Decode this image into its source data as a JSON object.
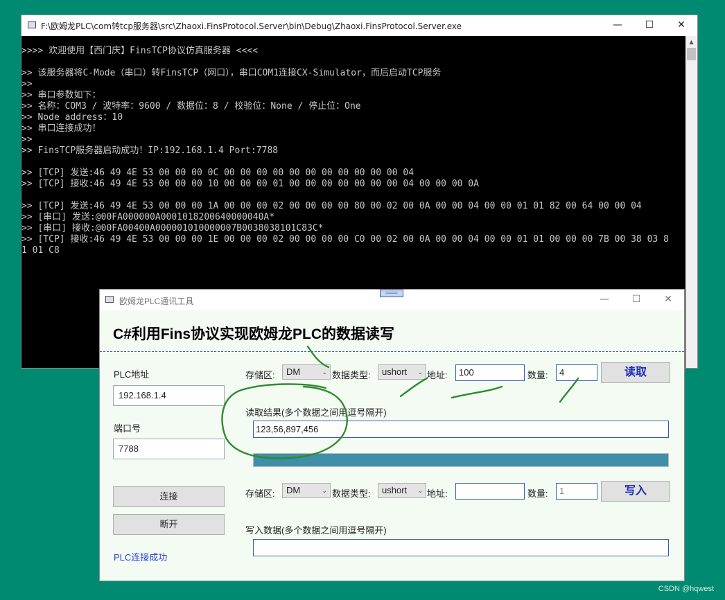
{
  "console": {
    "title": "F:\\欧姆龙PLC\\com转tcp服务器\\src\\Zhaoxi.FinsProtocol.Server\\bin\\Debug\\Zhaoxi.FinsProtocol.Server.exe",
    "minimize": "—",
    "maximize": "☐",
    "close": "✕",
    "scroll_up": "▲",
    "lines": [
      ">>>> 欢迎使用【西门庆】FinsTCP协议仿真服务器 <<<<",
      "",
      ">> 该服务器将C-Mode（串口）转FinsTCP（网口），串口COM1连接CX-Simulator，而后启动TCP服务",
      ">>",
      ">> 串口参数如下：",
      ">> 名称：COM3 / 波特率：9600 / 数据位：8 / 校验位：None / 停止位：One",
      ">> Node address：10",
      ">> 串口连接成功！",
      ">>",
      ">> FinsTCP服务器启动成功！IP:192.168.1.4  Port:7788",
      "",
      ">> [TCP] 发送:46 49 4E 53 00 00 00 0C 00 00 00 00 00 00 00 00 00 00 00 04",
      ">> [TCP] 接收:46 49 4E 53 00 00 00 10 00 00 00 01 00 00 00 00 00 00 00 04 00 00 00 0A",
      "",
      ">> [TCP] 发送:46 49 4E 53 00 00 00 1A 00 00 00 02 00 00 00 00 80 00 02 00 0A 00 00 04 00 00 01 01 82 00 64 00 00 04",
      ">> [串口] 发送:@00FA000000A0001018200640000040A*",
      ">> [串口] 接收:@00FA00400A000001010000007B0038038101C83C*",
      ">> [TCP] 接收:46 49 4E 53 00 00 00 1E 00 00 00 02 00 00 00 00 C0 00 02 00 0A 00 00 04 00 00 01 01 00 00 00 7B 00 38 03 8",
      "1 01 C8"
    ]
  },
  "form": {
    "title": "欧姆龙PLC通讯工具",
    "minimize": "—",
    "maximize": "☐",
    "close": "✕",
    "grip": "═══",
    "heading": "C#利用Fins协议实现欧姆龙PLC的数据读写",
    "plc_address_label": "PLC地址",
    "plc_address_value": "192.168.1.4",
    "port_label": "端口号",
    "port_value": "7788",
    "connect_button": "连接",
    "disconnect_button": "断开",
    "status_text": "PLC连接成功",
    "read": {
      "area_label": "存储区:",
      "area_value": "DM",
      "type_label": "数据类型:",
      "type_value": "ushort",
      "address_label": "地址:",
      "address_value": "100",
      "count_label": "数量:",
      "count_value": "4",
      "button": "读取",
      "result_label": "读取结果(多个数据之间用逗号隔开)",
      "result_value": "123,56,897,456",
      "progress": 1.0
    },
    "write": {
      "area_label": "存储区:",
      "area_value": "DM",
      "type_label": "数据类型:",
      "type_value": "ushort",
      "address_label": "地址:",
      "address_value": "",
      "count_label": "数量:",
      "count_value": "1",
      "button": "写入",
      "data_label": "写入数据(多个数据之间用逗号隔开)",
      "data_value": ""
    }
  },
  "watermark": "CSDN @hqwest",
  "colors": {
    "desktop": "#008a72",
    "console_bg": "#000000",
    "console_text": "#c8c8c8",
    "form_bg": "#f3fbf3",
    "progress_fill": "#3f8fa8",
    "annotation": "#2f8a2f",
    "button_text": "#1c2ab8",
    "status_text": "#2c3ed0"
  }
}
